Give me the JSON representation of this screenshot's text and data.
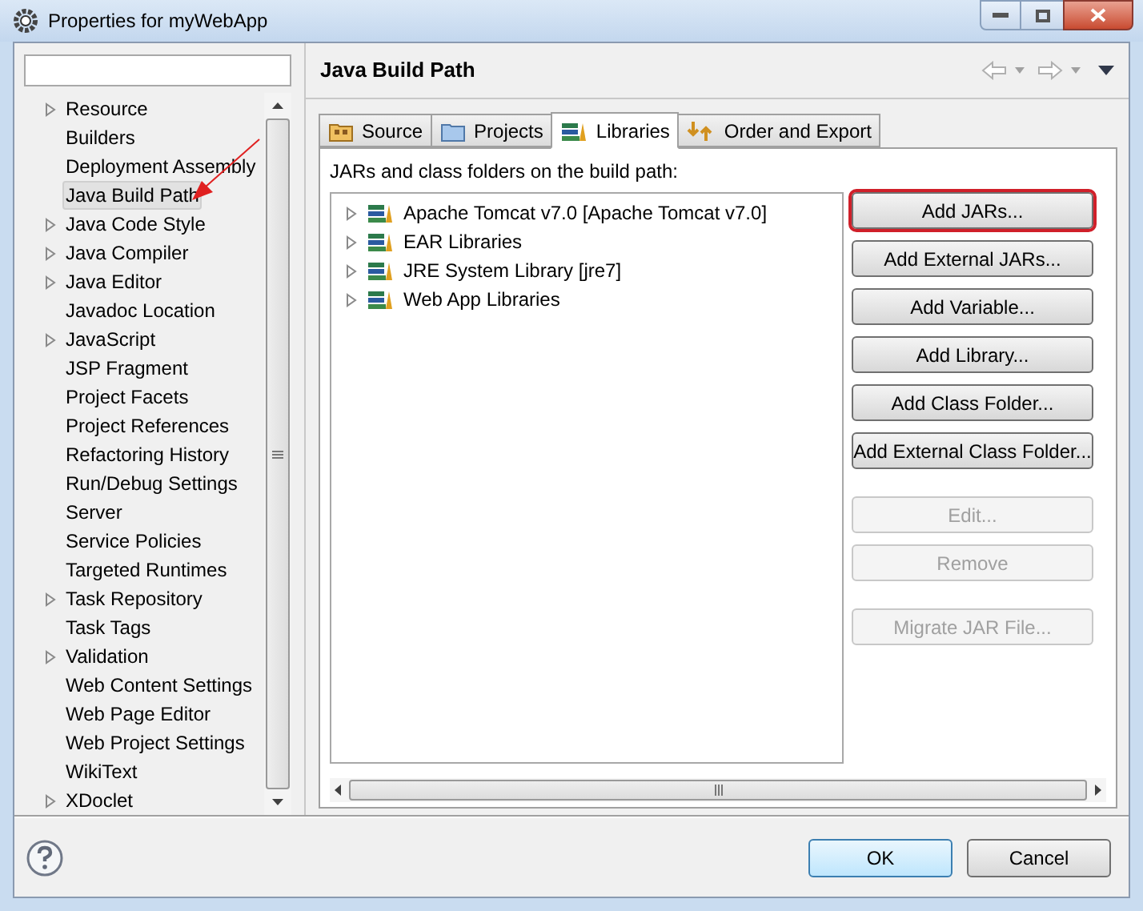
{
  "window": {
    "title": "Properties for myWebApp"
  },
  "sidebar": {
    "items": [
      {
        "label": "Resource",
        "expandable": true,
        "selected": false
      },
      {
        "label": "Builders",
        "expandable": false,
        "selected": false
      },
      {
        "label": "Deployment Assembly",
        "expandable": false,
        "selected": false
      },
      {
        "label": "Java Build Path",
        "expandable": false,
        "selected": true
      },
      {
        "label": "Java Code Style",
        "expandable": true,
        "selected": false
      },
      {
        "label": "Java Compiler",
        "expandable": true,
        "selected": false
      },
      {
        "label": "Java Editor",
        "expandable": true,
        "selected": false
      },
      {
        "label": "Javadoc Location",
        "expandable": false,
        "selected": false
      },
      {
        "label": "JavaScript",
        "expandable": true,
        "selected": false
      },
      {
        "label": "JSP Fragment",
        "expandable": false,
        "selected": false
      },
      {
        "label": "Project Facets",
        "expandable": false,
        "selected": false
      },
      {
        "label": "Project References",
        "expandable": false,
        "selected": false
      },
      {
        "label": "Refactoring History",
        "expandable": false,
        "selected": false
      },
      {
        "label": "Run/Debug Settings",
        "expandable": false,
        "selected": false
      },
      {
        "label": "Server",
        "expandable": false,
        "selected": false
      },
      {
        "label": "Service Policies",
        "expandable": false,
        "selected": false
      },
      {
        "label": "Targeted Runtimes",
        "expandable": false,
        "selected": false
      },
      {
        "label": "Task Repository",
        "expandable": true,
        "selected": false
      },
      {
        "label": "Task Tags",
        "expandable": false,
        "selected": false
      },
      {
        "label": "Validation",
        "expandable": true,
        "selected": false
      },
      {
        "label": "Web Content Settings",
        "expandable": false,
        "selected": false
      },
      {
        "label": "Web Page Editor",
        "expandable": false,
        "selected": false
      },
      {
        "label": "Web Project Settings",
        "expandable": false,
        "selected": false
      },
      {
        "label": "WikiText",
        "expandable": false,
        "selected": false
      },
      {
        "label": "XDoclet",
        "expandable": true,
        "selected": false
      }
    ]
  },
  "page": {
    "title": "Java Build Path",
    "tabs": [
      {
        "label": "Source",
        "kind": "source",
        "selected": false
      },
      {
        "label": "Projects",
        "kind": "projects",
        "selected": false
      },
      {
        "label": "Libraries",
        "kind": "libraries",
        "selected": true
      },
      {
        "label": "Order and Export",
        "kind": "order",
        "selected": false
      }
    ],
    "list_label": "JARs and class folders on the build path:",
    "libraries": [
      {
        "label": "Apache Tomcat v7.0 [Apache Tomcat v7.0]",
        "expanded": false
      },
      {
        "label": "EAR Libraries",
        "expanded": false
      },
      {
        "label": "JRE System Library [jre7]",
        "expanded": false
      },
      {
        "label": "Web App Libraries",
        "expanded": false
      }
    ],
    "button_groups": [
      [
        {
          "label": "Add JARs...",
          "disabled": false,
          "highlighted": true
        },
        {
          "label": "Add External JARs...",
          "disabled": false,
          "highlighted": false
        },
        {
          "label": "Add Variable...",
          "disabled": false,
          "highlighted": false
        },
        {
          "label": "Add Library...",
          "disabled": false,
          "highlighted": false
        },
        {
          "label": "Add Class Folder...",
          "disabled": false,
          "highlighted": false
        },
        {
          "label": "Add External Class Folder...",
          "disabled": false,
          "highlighted": false
        }
      ],
      [
        {
          "label": "Edit...",
          "disabled": true,
          "highlighted": false
        },
        {
          "label": "Remove",
          "disabled": true,
          "highlighted": false
        }
      ],
      [
        {
          "label": "Migrate JAR File...",
          "disabled": true,
          "highlighted": false
        }
      ]
    ]
  },
  "footer": {
    "buttons": [
      {
        "label": "OK",
        "default": true
      },
      {
        "label": "Cancel",
        "default": false
      }
    ]
  }
}
